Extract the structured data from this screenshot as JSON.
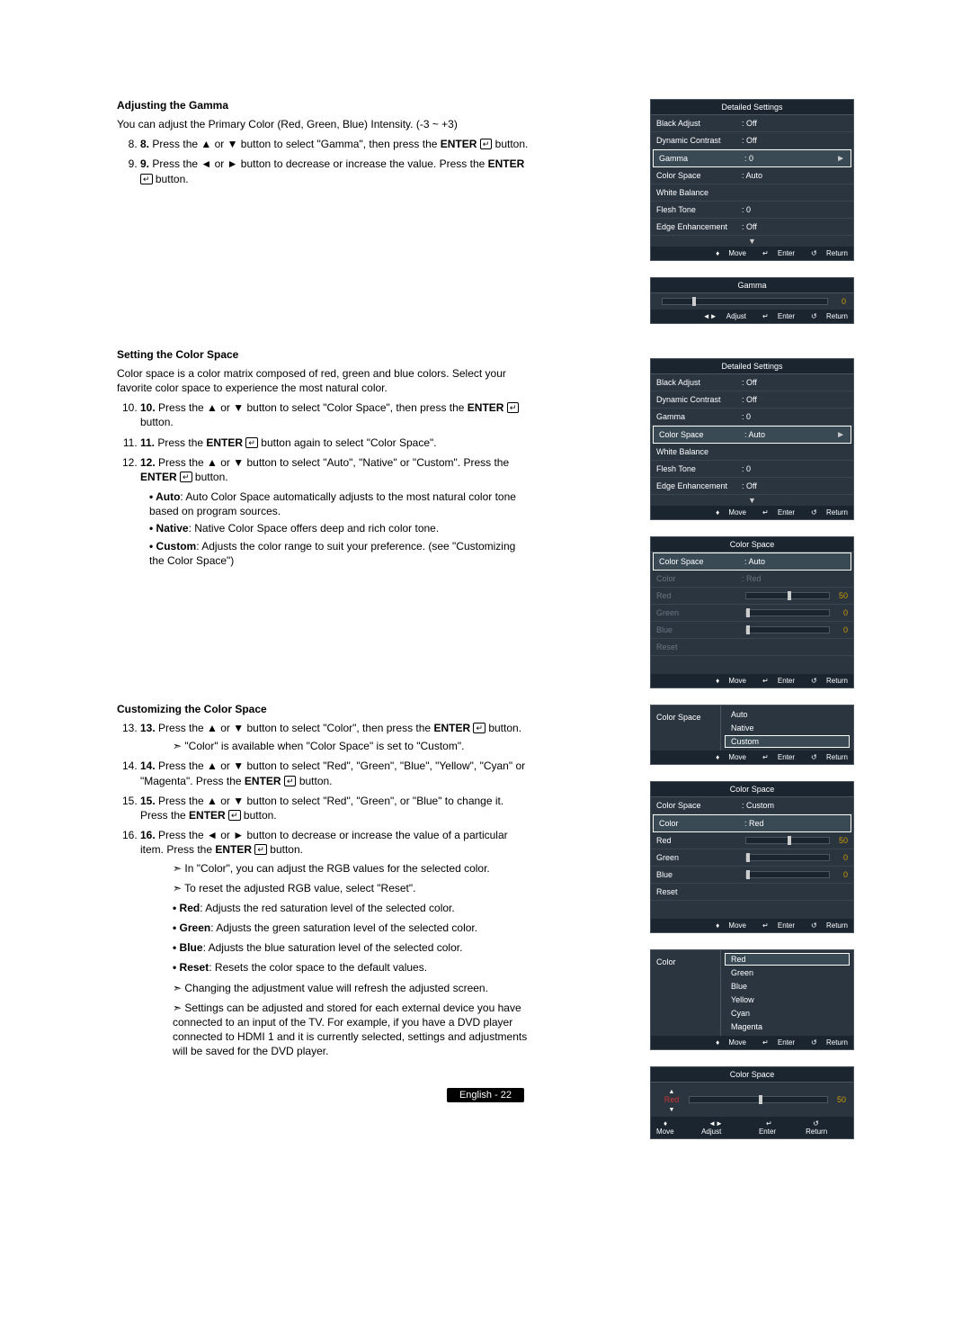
{
  "section1": {
    "heading": "Adjusting the Gamma",
    "intro": "You can adjust the Primary Color (Red, Green, Blue) Intensity. (-3 ~ +3)",
    "steps": [
      "Press the ▲ or ▼ button to select \"Gamma\", then press the ENTER button.",
      "Press the ◄ or ► button to decrease or increase the value. Press the ENTER button."
    ]
  },
  "section2": {
    "heading": "Setting the Color Space",
    "intro": "Color space is a color matrix composed of red, green and blue colors. Select your favorite color space to experience the most natural color.",
    "steps": [
      "Press the ▲ or ▼ button to select \"Color Space\", then press the ENTER button.",
      "Press the ENTER button again to select \"Color Space\".",
      "Press the ▲ or ▼ button to select \"Auto\", \"Native\" or \"Custom\". Press the ENTER button."
    ],
    "bullets": [
      {
        "label": "Auto",
        "text": ": Auto Color Space automatically adjusts to the most natural color tone based on program sources."
      },
      {
        "label": "Native",
        "text": ": Native Color Space offers deep and rich color tone."
      },
      {
        "label": "Custom",
        "text": ": Adjusts the color range to suit your preference. (see \"Customizing the Color Space\")"
      }
    ]
  },
  "section3": {
    "heading": "Customizing the Color Space",
    "steps": [
      "Press the ▲ or ▼ button to select \"Color\", then press the ENTER button.",
      "Press the ▲ or ▼ button to select \"Red\", \"Green\", \"Blue\", \"Yellow\", \"Cyan\" or \"Magenta\". Press the ENTER button.",
      "Press the ▲ or ▼ button to select \"Red\", \"Green\", or \"Blue\" to change it. Press the ENTER button.",
      "Press the ◄ or ► button to decrease or increase the value of a particular item. Press the ENTER button."
    ],
    "sub_arrow_1": "\"Color\" is available when \"Color Space\" is set to \"Custom\".",
    "sub_arrows_2": [
      "In \"Color\", you can adjust the RGB values for the selected color.",
      "To reset the adjusted RGB value, select \"Reset\"."
    ],
    "bullets2": [
      {
        "label": "Red",
        "text": ": Adjusts the red saturation level of the selected color."
      },
      {
        "label": "Green",
        "text": ": Adjusts the green saturation level of the selected color."
      },
      {
        "label": "Blue",
        "text": ": Adjusts the blue saturation level of the selected color."
      },
      {
        "label": "Reset",
        "text": ": Resets the color space to the default values."
      }
    ],
    "sub_arrows_3": [
      "Changing the adjustment value will refresh the adjusted screen.",
      "Settings can be adjusted and stored for each external device you have connected to an input of the TV. For example, if you have a DVD player connected to HDMI 1 and it is currently selected, settings and adjustments will be saved for the DVD player."
    ]
  },
  "osd": {
    "title_detailed": "Detailed Settings",
    "title_gamma": "Gamma",
    "title_colorspace": "Color Space",
    "rows": {
      "black_adjust": {
        "l": "Black Adjust",
        "v": ": Off"
      },
      "dynamic_contrast": {
        "l": "Dynamic Contrast",
        "v": ": Off"
      },
      "gamma": {
        "l": "Gamma",
        "v": ": 0"
      },
      "color_space_auto": {
        "l": "Color Space",
        "v": ": Auto"
      },
      "white_balance": {
        "l": "White Balance",
        "v": ""
      },
      "flesh_tone": {
        "l": "Flesh Tone",
        "v": ": 0"
      },
      "edge_enhancement": {
        "l": "Edge Enhancement",
        "v": ": Off"
      },
      "color_space_custom": {
        "l": "Color Space",
        "v": ": Custom"
      },
      "color_red": {
        "l": "Color",
        "v": ": Red"
      },
      "red": "Red",
      "green": "Green",
      "blue": "Blue",
      "reset": "Reset",
      "auto": "Auto",
      "native": "Native",
      "custom": "Custom",
      "yellow": "Yellow",
      "cyan": "Cyan",
      "magenta": "Magenta"
    },
    "foot": {
      "move": "Move",
      "enter": "Enter",
      "return": "Return",
      "adjust": "Adjust"
    },
    "vals": {
      "red": "50",
      "green": "0",
      "blue": "0",
      "gamma": "0"
    }
  },
  "footer": "English - 22"
}
